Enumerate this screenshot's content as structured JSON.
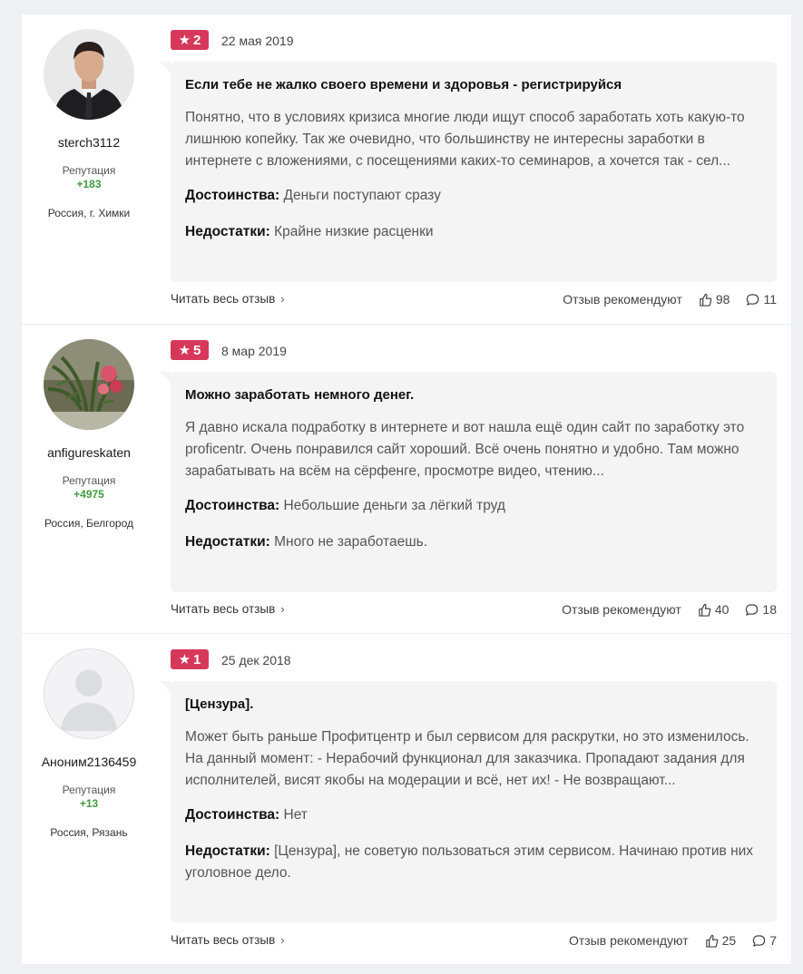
{
  "reviews": [
    {
      "author": {
        "username": "sterch3112",
        "reputation_label": "Репутация",
        "reputation": "+183",
        "location": "Россия, г. Химки",
        "avatar": "man-in-suit-photo"
      },
      "rating": "2",
      "date": "22 мая 2019",
      "title": "Если тебе не жалко своего времени и здоровья - регистрируйся",
      "excerpt": "Понятно, что в условиях кризиса многие люди ищут способ заработать хоть какую-то лишнюю копейку. Так же очевидно, что большинству не интересны заработки в интернете с вложениями, с посещениями каких-то семинаров, а хочется так - сел...",
      "pros_label": "Достоинства:",
      "pros": "Деньги поступают сразу",
      "cons_label": "Недостатки:",
      "cons": "Крайне низкие расценки",
      "read_more": "Читать весь отзыв",
      "recommend_label": "Отзыв рекомендуют",
      "likes": "98",
      "comments": "11"
    },
    {
      "author": {
        "username": "anfigureskaten",
        "reputation_label": "Репутация",
        "reputation": "+4975",
        "location": "Россия, Белгород",
        "avatar": "flower-photo"
      },
      "rating": "5",
      "date": "8 мар 2019",
      "title": "Можно заработать немного денег.",
      "excerpt": "Я давно искала подработку в интернете и вот нашла ещё один сайт по заработку это proficentr. Очень понравился сайт хороший. Всё очень понятно и удобно. Там можно зарабатывать на всём на сёрфенге, просмотре видео, чтению...",
      "pros_label": "Достоинства:",
      "pros": "Небольшие деньги за лёгкий труд",
      "cons_label": "Недостатки:",
      "cons": "Много не заработаешь.",
      "read_more": "Читать весь отзыв",
      "recommend_label": "Отзыв рекомендуют",
      "likes": "40",
      "comments": "18"
    },
    {
      "author": {
        "username": "Аноним2136459",
        "reputation_label": "Репутация",
        "reputation": "+13",
        "location": "Россия, Рязань",
        "avatar": "default-user-avatar"
      },
      "rating": "1",
      "date": "25 дек 2018",
      "title": "[Цензура].",
      "excerpt": "Может быть раньше Профитцентр и был сервисом для раскрутки, но это изменилось. На данный момент: - Нерабочий функционал для заказчика. Пропадают задания для исполнителей, висят якобы на модерации и всё, нет их! - Не возвращают...",
      "pros_label": "Достоинства:",
      "pros": "Нет",
      "cons_label": "Недостатки:",
      "cons": "[Цензура], не советую пользоваться этим сервисом. Начинаю против них уголовное дело.",
      "read_more": "Читать весь отзыв",
      "recommend_label": "Отзыв рекомендуют",
      "likes": "25",
      "comments": "7"
    }
  ],
  "colors": {
    "rating_badge": "#d6385b",
    "reputation": "#3e9b3e",
    "bubble": "#f4f4f5"
  }
}
